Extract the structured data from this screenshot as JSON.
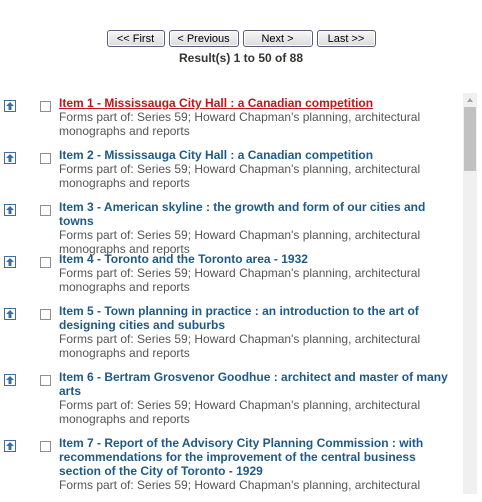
{
  "pager": {
    "first": "<< First",
    "previous": "< Previous",
    "next": "Next >",
    "last": "Last >>"
  },
  "results": {
    "summary": "Result(s) 1 to 50 of 88"
  },
  "items": [
    {
      "title": "Item 1 - Mississauga City Hall : a Canadian competition",
      "desc": "Forms part of: Series 59; Howard Chapman's planning, architectural monographs and reports"
    },
    {
      "title": "Item 2 - Mississauga City Hall : a Canadian competition",
      "desc": "Forms part of: Series 59; Howard Chapman's planning, architectural monographs and reports"
    },
    {
      "title": "Item 3 - American skyline : the growth and form of our cities and towns",
      "desc": "Forms part of: Series 59; Howard Chapman's planning, architectural monographs and reports"
    },
    {
      "title": "Item 4 - Toronto and the Toronto area - 1932",
      "desc": "Forms part of: Series 59; Howard Chapman's planning, architectural monographs and reports"
    },
    {
      "title": "Item 5 - Town planning in practice : an introduction to the art of designing cities and suburbs",
      "desc": "Forms part of: Series 59; Howard Chapman's planning, architectural monographs and reports"
    },
    {
      "title": "Item 6 - Bertram Grosvenor Goodhue : architect and master of many arts",
      "desc": "Forms part of: Series 59; Howard Chapman's planning, architectural monographs and reports"
    },
    {
      "title": "Item 7 - Report of the Advisory City Planning Commission : with recommendations for the improvement of the central business section of the City of Toronto - 1929",
      "desc": "Forms part of: Series 59; Howard Chapman's planning, architectural"
    }
  ]
}
